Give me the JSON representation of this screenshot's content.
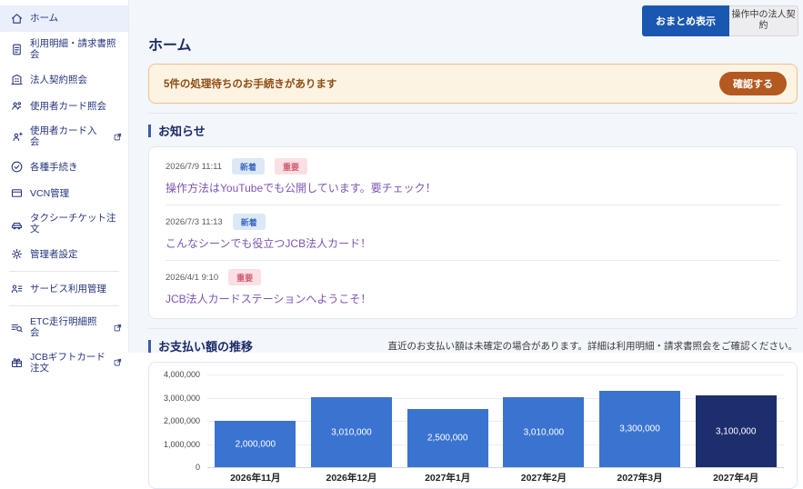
{
  "colors": {
    "primary_blue": "#1a57b0",
    "sidebar_text": "#26357d",
    "active_item_bg": "#e9effb",
    "alert_bg": "#fcf3e3",
    "alert_border": "#eec08f",
    "alert_text": "#8f4c12",
    "confirm_button": "#b4591f",
    "badge_new_bg": "#dde8f7",
    "badge_new_text": "#3f6cc1",
    "badge_important_bg": "#fadfe4",
    "badge_important_text": "#d15a70",
    "link_purple": "#7d55b2",
    "bar_blue": "#3a73d0",
    "bar_highlight": "#1d2e6e"
  },
  "sidebar": {
    "items": [
      {
        "label": "ホーム",
        "icon": "home",
        "active": true,
        "external": false,
        "divider_after": false
      },
      {
        "label": "利用明細・請求書照会",
        "icon": "document",
        "active": false,
        "external": false,
        "divider_after": false
      },
      {
        "label": "法人契約照会",
        "icon": "building",
        "active": false,
        "external": false,
        "divider_after": false
      },
      {
        "label": "使用者カード照会",
        "icon": "users",
        "active": false,
        "external": false,
        "divider_after": false
      },
      {
        "label": "使用者カード入会",
        "icon": "user-plus",
        "active": false,
        "external": true,
        "divider_after": false
      },
      {
        "label": "各種手続き",
        "icon": "check-circle",
        "active": false,
        "external": false,
        "divider_after": false
      },
      {
        "label": "VCN管理",
        "icon": "card",
        "active": false,
        "external": false,
        "divider_after": false
      },
      {
        "label": "タクシーチケット注文",
        "icon": "taxi",
        "active": false,
        "external": false,
        "divider_after": false
      },
      {
        "label": "管理者設定",
        "icon": "gear",
        "active": false,
        "external": false,
        "divider_after": true
      },
      {
        "label": "サービス利用管理",
        "icon": "user-list",
        "active": false,
        "external": false,
        "divider_after": true
      },
      {
        "label": "ETC走行明細照会",
        "icon": "list-search",
        "active": false,
        "external": true,
        "divider_after": false
      },
      {
        "label": "JCBギフトカード注文",
        "icon": "gift",
        "active": false,
        "external": true,
        "divider_after": false
      }
    ]
  },
  "header": {
    "summary_button": "おまとめ表示",
    "contract_button": "操作中の法人契約"
  },
  "page": {
    "title": "ホーム"
  },
  "alert": {
    "message": "5件の処理待ちのお手続きがあります",
    "confirm_label": "確認する"
  },
  "news": {
    "section_title": "お知らせ",
    "badge_labels": {
      "new": "新着",
      "important": "重要"
    },
    "items": [
      {
        "date": "2026/7/9 11:11",
        "badges": [
          "new",
          "important"
        ],
        "title": "操作方法はYouTubeでも公開しています。要チェック！"
      },
      {
        "date": "2026/7/3 11:13",
        "badges": [
          "new"
        ],
        "title": "こんなシーンでも役立つJCB法人カード！"
      },
      {
        "date": "2026/4/1 9:10",
        "badges": [
          "important"
        ],
        "title": "JCB法人カードステーションへようこそ！"
      }
    ]
  },
  "payments": {
    "section_title": "お支払い額の推移",
    "note": "直近のお支払い額は未確定の場合があります。詳細は利用明細・請求書照会をご確認ください。"
  },
  "chart_data": {
    "type": "bar",
    "categories": [
      "2026年11月",
      "2026年12月",
      "2027年1月",
      "2027年2月",
      "2027年3月",
      "2027年4月"
    ],
    "values": [
      2000000,
      3010000,
      2500000,
      3010000,
      3300000,
      3100000
    ],
    "value_labels": [
      "2,000,000",
      "3,010,000",
      "2,500,000",
      "3,010,000",
      "3,300,000",
      "3,100,000"
    ],
    "title": "お支払い額の推移",
    "xlabel": "",
    "ylabel": "",
    "ylim": [
      0,
      4000000
    ],
    "yticks": [
      "0",
      "1,000,000",
      "2,000,000",
      "3,000,000",
      "4,000,000"
    ],
    "grid": true,
    "legend": false,
    "bar_color": "#3a73d0",
    "highlight_index": 5,
    "highlight_color": "#1d2e6e"
  }
}
